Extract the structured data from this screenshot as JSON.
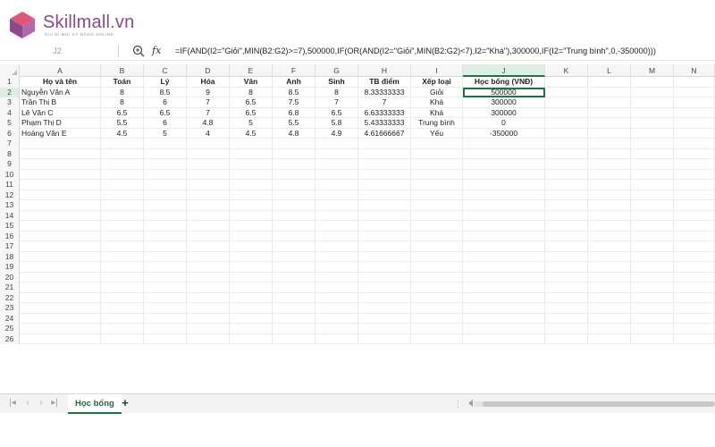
{
  "logo": {
    "name": "Skillmall.vn",
    "tagline": "GIA DỊ MỌI KỸ NĂNG ONLINE"
  },
  "formula_bar": {
    "name_box": "J2",
    "fx_label": "fx",
    "formula": "=IF(AND(I2=\"Giỏi\",MIN(B2:G2)>=7),500000,IF(OR(AND(I2=\"Giỏi\",MIN(B2:G2)<7),I2=\"Khá\"),300000,IF(I2=\"Trung bình\",0,-350000)))"
  },
  "columns": [
    "A",
    "B",
    "C",
    "D",
    "E",
    "F",
    "G",
    "H",
    "I",
    "J",
    "K",
    "L",
    "M",
    "N"
  ],
  "active_column": "J",
  "row_numbers": [
    "1",
    "2",
    "3",
    "4",
    "5",
    "6",
    "7",
    "8",
    "9",
    "10",
    "11",
    "12",
    "13",
    "14",
    "15",
    "16",
    "17",
    "18",
    "19",
    "20",
    "21",
    "22",
    "23",
    "24",
    "25",
    "26"
  ],
  "active_row": "2",
  "headers": [
    "Họ và tên",
    "Toán",
    "Lý",
    "Hóa",
    "Văn",
    "Anh",
    "Sinh",
    "TB điểm",
    "Xếp loại",
    "Học bổng (VNĐ)"
  ],
  "table": [
    [
      "Nguyễn Văn A",
      "8",
      "8.5",
      "9",
      "8",
      "8.5",
      "8",
      "8.33333333",
      "Giỏi",
      "500000"
    ],
    [
      "Trần Thị B",
      "8",
      "6",
      "7",
      "6.5",
      "7.5",
      "7",
      "7",
      "Khá",
      "300000"
    ],
    [
      "Lê Văn C",
      "6.5",
      "6.5",
      "7",
      "6.5",
      "6.8",
      "6.5",
      "6.63333333",
      "Khá",
      "300000"
    ],
    [
      "Phạm Thị D",
      "5.5",
      "6",
      "4.8",
      "5",
      "5.5",
      "5.8",
      "5.43333333",
      "Trung bình",
      "0"
    ],
    [
      "Hoàng Văn E",
      "4.5",
      "5",
      "4",
      "4.5",
      "4.8",
      "4.9",
      "4.61666667",
      "Yếu",
      "-350000"
    ]
  ],
  "selected_cell": "J2",
  "sheet_tab": "Học bổng",
  "add_sheet": "+",
  "nav_icons": [
    "first-sheet",
    "prev-sheet",
    "next-sheet",
    "last-sheet"
  ],
  "colors": {
    "accent": "#217346",
    "logo": "#8a4a8c",
    "logo_accent": "#e2567a"
  }
}
